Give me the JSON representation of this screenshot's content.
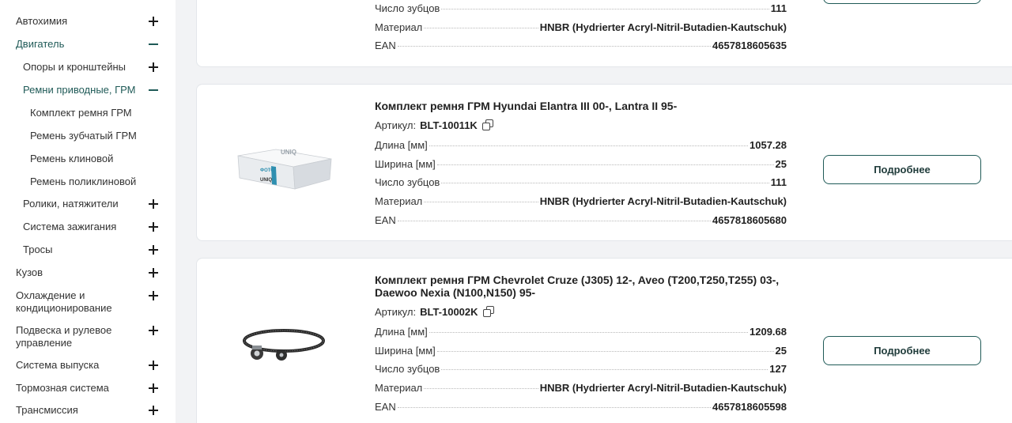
{
  "sidebar": {
    "items": [
      {
        "label": "Автохимия",
        "toggle": "+"
      },
      {
        "label": "Двигатель",
        "toggle": "−"
      },
      {
        "label": "Опоры и кронштейны",
        "toggle": "+"
      },
      {
        "label": "Ремни приводные, ГРМ",
        "toggle": "−"
      },
      {
        "label": "Комплект ремня ГРМ"
      },
      {
        "label": "Ремень зубчатый ГРМ"
      },
      {
        "label": "Ремень клиновой"
      },
      {
        "label": "Ремень поликлиновой"
      },
      {
        "label": "Ролики, натяжители",
        "toggle": "+"
      },
      {
        "label": "Система зажигания",
        "toggle": "+"
      },
      {
        "label": "Тросы",
        "toggle": "+"
      },
      {
        "label": "Кузов",
        "toggle": "+"
      },
      {
        "label": "Охлаждение и кондиционирование",
        "toggle": "+"
      },
      {
        "label": "Подвеска и рулевое управление",
        "toggle": "+"
      },
      {
        "label": "Система выпуска",
        "toggle": "+"
      },
      {
        "label": "Тормозная система",
        "toggle": "+"
      },
      {
        "label": "Трансмиссия",
        "toggle": "+"
      }
    ]
  },
  "products": [
    {
      "specs": [
        {
          "key": "Число зубцов",
          "value": "111"
        },
        {
          "key": "Материал",
          "value": "HNBR (Hydrierter Acryl-Nitril-Butadien-Kautschuk)"
        },
        {
          "key": "EAN",
          "value": "4657818605635"
        }
      ]
    },
    {
      "title": "Комплект ремня ГРМ Hyundai Elantra III 00-, Lantra II 95-",
      "article_label": "Артикул:",
      "article": "BLT-10011K",
      "image_label": "ФОТО",
      "image_brand": "UNIQ",
      "button": "Подробнее",
      "specs": [
        {
          "key": "Длина [мм]",
          "value": "1057.28"
        },
        {
          "key": "Ширина [мм]",
          "value": "25"
        },
        {
          "key": "Число зубцов",
          "value": "111"
        },
        {
          "key": "Материал",
          "value": "HNBR (Hydrierter Acryl-Nitril-Butadien-Kautschuk)"
        },
        {
          "key": "EAN",
          "value": "4657818605680"
        }
      ]
    },
    {
      "title": "Комплект ремня ГРМ Chevrolet Cruze (J305) 12-, Aveo (T200,T250,T255) 03-, Daewoo Nexia (N100,N150) 95-",
      "article_label": "Артикул:",
      "article": "BLT-10002K",
      "button": "Подробнее",
      "specs": [
        {
          "key": "Длина [мм]",
          "value": "1209.68"
        },
        {
          "key": "Ширина [мм]",
          "value": "25"
        },
        {
          "key": "Число зубцов",
          "value": "127"
        },
        {
          "key": "Материал",
          "value": "HNBR (Hydrierter Acryl-Nitril-Butadien-Kautschuk)"
        },
        {
          "key": "EAN",
          "value": "4657818605598"
        }
      ]
    }
  ],
  "colors": {
    "accent": "#1f5a57",
    "background": "#f2f3f5",
    "card": "#ffffff"
  }
}
